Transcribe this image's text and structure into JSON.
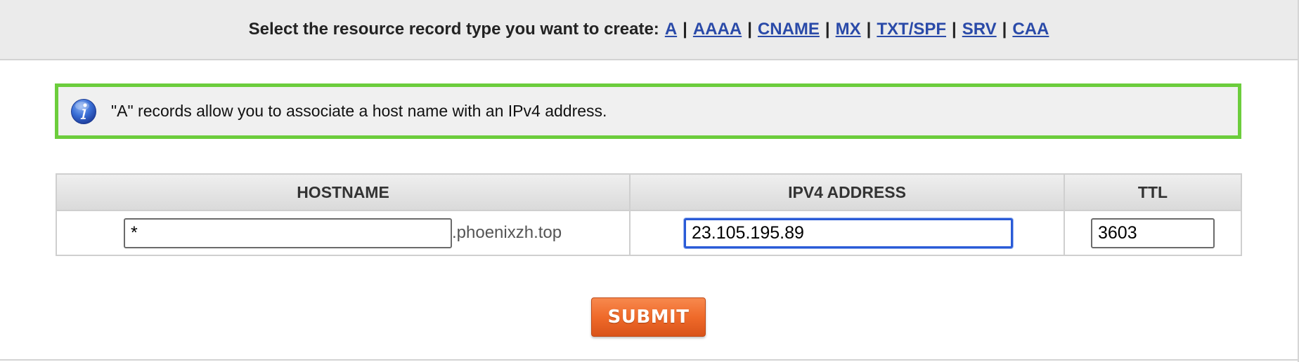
{
  "header": {
    "prompt": "Select the resource record type you want to create:",
    "record_types": [
      "A",
      "AAAA",
      "CNAME",
      "MX",
      "TXT/SPF",
      "SRV",
      "CAA"
    ],
    "separator": "|"
  },
  "info": {
    "icon": "info-icon",
    "text": "\"A\" records allow you to associate a host name with an IPv4 address.",
    "border_color": "#6ccd3c"
  },
  "table": {
    "columns": [
      "HOSTNAME",
      "IPV4 ADDRESS",
      "TTL"
    ],
    "hostname_value": "*",
    "domain_suffix": ".phoenixzh.top",
    "ipv4_value": "23.105.195.89",
    "ttl_value": "3603"
  },
  "submit": {
    "label": "SUBMIT",
    "color": "#ef6a2a"
  },
  "colors": {
    "link": "#2a4aa8",
    "focus_border": "#2a5bd7"
  }
}
